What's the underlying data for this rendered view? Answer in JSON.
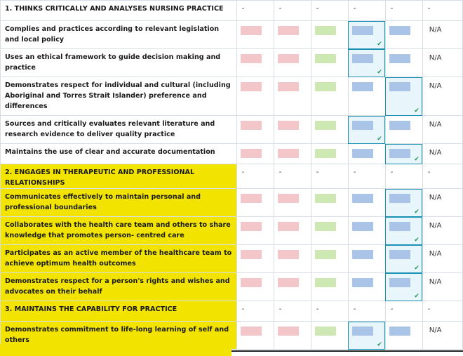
{
  "rows": [
    {
      "type": "section",
      "label": "1. THINKS CRITICALLY AND ANALYSES NURSING PRACTICE",
      "highlight": false,
      "cells": [
        "-",
        "-",
        "-",
        "-",
        "-",
        "-"
      ]
    },
    {
      "type": "criterion",
      "label": "Complies and practices according to relevant legislation and local policy",
      "highlight": false,
      "selected_col": 4,
      "na": "N/A"
    },
    {
      "type": "criterion",
      "label": "Uses an ethical framework to guide decision making and practice",
      "highlight": false,
      "selected_col": 4,
      "na": "N/A"
    },
    {
      "type": "criterion",
      "label": "Demonstrates respect for individual and cultural (including Aboriginal and Torres Strait Islander) preference and differences",
      "highlight": false,
      "selected_col": 5,
      "na": "N/A"
    },
    {
      "type": "criterion",
      "label": "Sources and critically evaluates relevant literature and research evidence to deliver quality practice",
      "highlight": false,
      "selected_col": 4,
      "na": "N/A"
    },
    {
      "type": "criterion",
      "label": "Maintains the use of clear and accurate documentation",
      "highlight": false,
      "selected_col": 5,
      "na": "N/A"
    },
    {
      "type": "section",
      "label": "2. ENGAGES IN THERAPEUTIC AND PROFESSIONAL RELATIONSHIPS",
      "highlight": true,
      "cells": [
        "-",
        "-",
        "-",
        "-",
        "-",
        "-"
      ]
    },
    {
      "type": "criterion",
      "label": "Communicates effectively to maintain personal and professional boundaries",
      "highlight": true,
      "selected_col": 5,
      "na": "N/A"
    },
    {
      "type": "criterion",
      "label": "Collaborates with the health care team and others to share knowledge that promotes person- centred care",
      "highlight": true,
      "selected_col": 5,
      "na": "N/A"
    },
    {
      "type": "criterion",
      "label": "Participates as an active member of the healthcare team to achieve optimum health outcomes",
      "highlight": true,
      "selected_col": 5,
      "na": "N/A"
    },
    {
      "type": "criterion",
      "label": "Demonstrates respect for a person's rights and wishes and advocates on their behalf",
      "highlight": true,
      "selected_col": 5,
      "na": "N/A"
    },
    {
      "type": "section",
      "label": "3. MAINTAINS THE CAPABILITY FOR PRACTICE",
      "highlight": true,
      "cells": [
        "-",
        "-",
        "-",
        "-",
        "-",
        "-"
      ]
    },
    {
      "type": "criterion",
      "label": "Demonstrates commitment to life-long learning of self and others",
      "highlight": true,
      "selected_col": 4,
      "na": "N/A"
    }
  ],
  "swatch_colors": {
    "col1": "#f3c6c9",
    "col2": "#f3c6c9",
    "col3": "#cde8b3",
    "col4": "#a9c4e6",
    "col5": "#a9c4e6"
  },
  "accent": {
    "highlight": "#f2e400",
    "selected_border": "#1b8fb2",
    "check": "#1f9a5b"
  },
  "icons": {
    "check": "check-icon"
  }
}
